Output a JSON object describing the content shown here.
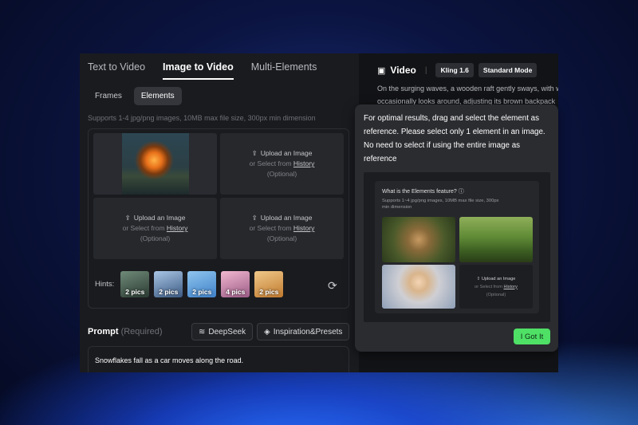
{
  "tabs": [
    "Text to Video",
    "Image to Video",
    "Multi-Elements"
  ],
  "subtabs": [
    "Frames",
    "Elements"
  ],
  "support_text": "Supports 1-4 jpg/png images, 10MB max file size, 300px min dimension",
  "upload": {
    "title": "Upload an Image",
    "or_select": "or Select from",
    "history": "History",
    "optional": "(Optional)"
  },
  "hints": {
    "label": "Hints:",
    "items": [
      "2 pics",
      "2 pics",
      "2 pics",
      "4 pics",
      "2 pics"
    ]
  },
  "prompt": {
    "label": "Prompt",
    "required": "(Required)",
    "deepseek": "DeepSeek",
    "inspiration": "Inspiration&Presets",
    "text": "Snowflakes fall as a car moves along the road."
  },
  "video": {
    "title": "Video",
    "model": "Kling 1.6",
    "mode": "Standard Mode",
    "desc_line1": "On the surging waves, a wooden raft gently sways, with w",
    "desc_line2": "occasionally looks around, adjusting its brown backpack"
  },
  "popup": {
    "text": "For optimal results, drag and select the element as reference. Please select only 1 element in an image. No need to select if using the entire image as reference",
    "demo_title": "What is the Elements feature?",
    "demo_sub": "Supports 1~4 jpg/png images, 10MB max file size, 300px min dimension",
    "button": "I Got It"
  }
}
